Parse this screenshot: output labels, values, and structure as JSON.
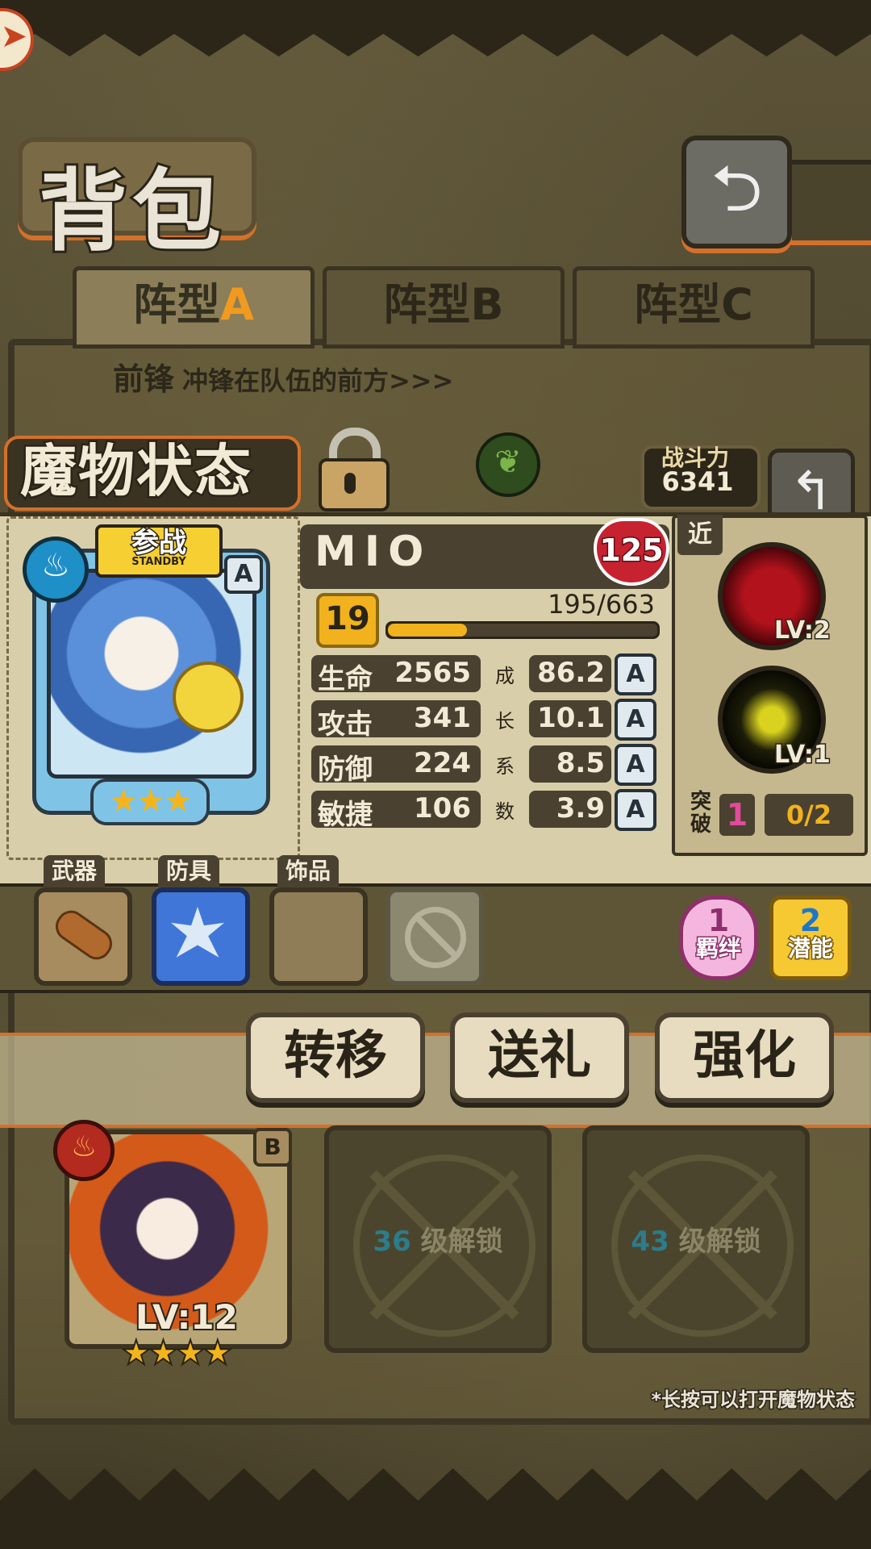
{
  "page": {
    "title": "背包",
    "corner_icon": "arrow-icon",
    "back_icon": "return-arrow-icon"
  },
  "tabs": [
    {
      "prefix": "阵型",
      "suffix": "A",
      "active": true
    },
    {
      "prefix": "阵型",
      "suffix": "B",
      "active": false
    },
    {
      "prefix": "阵型",
      "suffix": "C",
      "active": false
    }
  ],
  "position": {
    "label": "前锋",
    "description": "冲锋在队伍的前方>>>"
  },
  "monster_status": {
    "title": "魔物状态",
    "power_label": "战斗力",
    "power_value": "6341",
    "element_icon": "leaf-icon"
  },
  "character": {
    "name": "MIO",
    "affection": "125",
    "standby_zh": "参战",
    "standby_en": "STANDBY",
    "grade": "A",
    "element_icon": "water-icon",
    "stars": 3,
    "stars_text": "★★★",
    "level": "19",
    "xp_text": "195/663",
    "xp_fraction": 0.294,
    "stats": [
      {
        "label": "生命",
        "value": "2565",
        "growth": "86.2",
        "grade": "A"
      },
      {
        "label": "攻击",
        "value": "341",
        "growth": "10.1",
        "grade": "A"
      },
      {
        "label": "防御",
        "value": "224",
        "growth": "8.5",
        "grade": "A"
      },
      {
        "label": "敏捷",
        "value": "106",
        "growth": "3.9",
        "grade": "A"
      }
    ],
    "growth_label": [
      "成",
      "长",
      "系",
      "数"
    ]
  },
  "skills": {
    "range": "近",
    "items": [
      {
        "icon": "paw-icon",
        "level": "LV:2"
      },
      {
        "icon": "lightning-icon",
        "level": "LV:1"
      }
    ],
    "break_label": "突破",
    "break_value": "1",
    "break_progress": "0/2"
  },
  "equipment": {
    "slots": [
      {
        "label": "武器",
        "icon": "bread-icon"
      },
      {
        "label": "防具",
        "icon": "crystal-icon"
      },
      {
        "label": "饰品",
        "icon": ""
      },
      {
        "label": "",
        "icon": "ban-icon"
      }
    ],
    "bond": {
      "count": "1",
      "label": "羁绊"
    },
    "potential": {
      "count": "2",
      "label": "潜能"
    }
  },
  "actions": {
    "transfer": "转移",
    "gift": "送礼",
    "enhance": "强化"
  },
  "team": {
    "member": {
      "level": "LV:12",
      "grade": "B",
      "element_icon": "fire-icon",
      "stars_text": "★★★★"
    },
    "locked": [
      {
        "num": "36",
        "text": "级解锁"
      },
      {
        "num": "43",
        "text": "级解锁"
      }
    ]
  },
  "hint": "*长按可以打开魔物状态"
}
